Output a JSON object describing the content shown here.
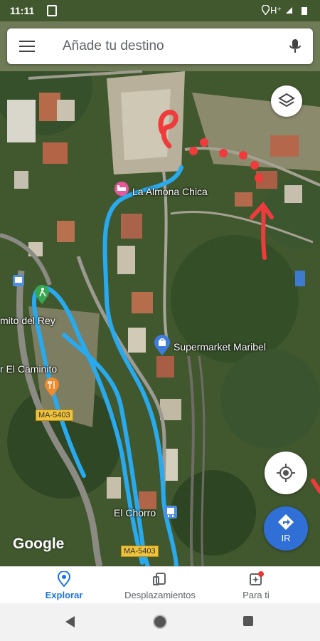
{
  "status_bar": {
    "time": "11:11",
    "network": "H⁺"
  },
  "search": {
    "placeholder": "Añade tu destino"
  },
  "map": {
    "places": {
      "hotel": "La Almona Chica",
      "supermarket": "Supermarket Maribel",
      "trail": "mito del Rey",
      "restaurant": "r El Caminito",
      "station": "El Chorro"
    },
    "roads": {
      "shield_1": "MA-5403",
      "shield_2": "MA-5403"
    },
    "attribution": "Google"
  },
  "buttons": {
    "go": "IR"
  },
  "bottom_nav": {
    "items": [
      {
        "label": "Explorar",
        "active": true
      },
      {
        "label": "Desplazamientos",
        "active": false
      },
      {
        "label": "Para ti",
        "active": false
      }
    ]
  },
  "colors": {
    "accent": "#1a73e8",
    "go_button": "#2f6fd6",
    "drawn_route": "#29a9ee",
    "drawn_marks": "#ef3b3b"
  }
}
